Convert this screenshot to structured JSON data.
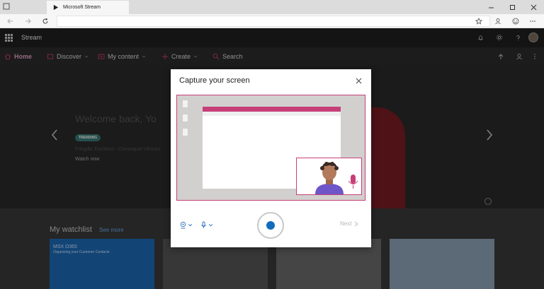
{
  "browser": {
    "tab_title": "Microsoft Stream",
    "window_controls": [
      "minimize-icon",
      "maximize-icon",
      "close-icon"
    ],
    "address_url": "",
    "toolbar_icons": [
      "star-icon",
      "profile-icon",
      "emoji-icon",
      "more-icon"
    ]
  },
  "header": {
    "app_name": "Stream",
    "icons": [
      "bell-icon",
      "gear-icon",
      "help-icon",
      "avatar"
    ]
  },
  "nav": {
    "items": [
      {
        "label": "Home",
        "icon": "home-icon"
      },
      {
        "label": "Discover",
        "icon": "discover-icon"
      },
      {
        "label": "My content",
        "icon": "video-icon"
      },
      {
        "label": "Create",
        "icon": "plus-icon"
      },
      {
        "label": "Search",
        "icon": "search-icon"
      }
    ]
  },
  "hero": {
    "welcome": "Welcome back, Yo",
    "badge": "TRENDING",
    "subtitle": "Fringilla Tincidunt - Consequat Ultrices",
    "watch_now": "Watch now"
  },
  "watchlist": {
    "title": "My watchlist",
    "see_more": "See more",
    "thumb1_title": "MSX D365",
    "thumb1_sub": "Organizing your Customer Contacts"
  },
  "modal": {
    "title": "Capture your screen",
    "next_label": "Next",
    "colors": {
      "accent": "#c63f78",
      "record": "#0f6cbd"
    }
  }
}
